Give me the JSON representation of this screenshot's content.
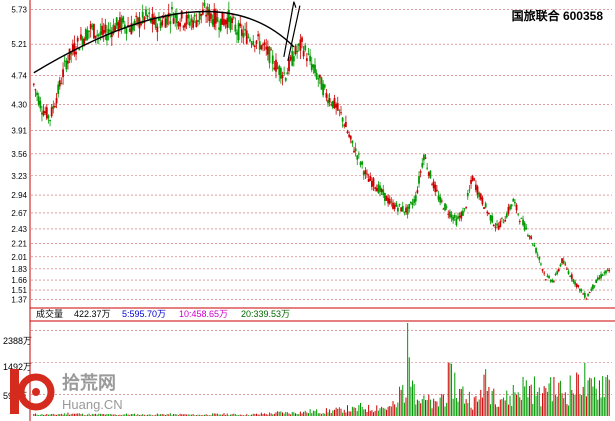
{
  "chart_data": [
    {
      "type": "candlestick",
      "title": "国旅联合 600358",
      "ylim": [
        1.3,
        5.8
      ],
      "y_ticks": [
        5.73,
        5.21,
        4.74,
        4.3,
        3.91,
        3.56,
        3.23,
        2.94,
        2.67,
        2.43,
        2.21,
        2.01,
        1.83,
        1.66,
        1.51,
        1.37
      ],
      "grid": true,
      "trend_points": [
        4.6,
        4.25,
        4.1,
        4.5,
        4.95,
        5.15,
        5.3,
        5.45,
        5.35,
        5.38,
        5.48,
        5.52,
        5.46,
        5.55,
        5.62,
        5.5,
        5.58,
        5.67,
        5.6,
        5.55,
        5.58,
        5.7,
        5.62,
        5.55,
        5.6,
        5.42,
        5.35,
        5.3,
        5.2,
        5.05,
        4.85,
        4.75,
        5.05,
        5.2,
        4.95,
        4.7,
        4.45,
        4.3,
        4.1,
        3.75,
        3.5,
        3.2,
        3.1,
        2.95,
        2.8,
        2.75,
        2.7,
        2.9,
        3.55,
        3.15,
        2.85,
        2.7,
        2.55,
        2.7,
        3.2,
        2.9,
        2.65,
        2.45,
        2.6,
        2.85,
        2.55,
        2.35,
        2.05,
        1.7,
        1.65,
        1.95,
        1.75,
        1.55,
        1.4,
        1.6,
        1.75,
        1.8
      ],
      "annotations": {
        "arc": {
          "from_index": 0,
          "peak_index": 22,
          "to_index": 32,
          "note": "arched top drawn over the price"
        },
        "spike": {
          "index": 32,
          "high": 5.85
        }
      }
    },
    {
      "type": "bar",
      "title": "",
      "legend": {
        "label": "成交量",
        "items": [
          {
            "text": "422.37万",
            "color": "#000000"
          },
          {
            "text": "5:595.70万",
            "color": "#0000cc"
          },
          {
            "text": "10:458.65万",
            "color": "#cc00cc"
          },
          {
            "text": "20:339.53万",
            "color": "#006600"
          }
        ]
      },
      "y_ticks": [
        "2388万",
        "1492万",
        "597万"
      ],
      "ylim": [
        0,
        2600
      ],
      "levels": [
        60,
        55,
        50,
        70,
        90,
        75,
        60,
        55,
        60,
        50,
        45,
        60,
        55,
        50,
        45,
        55,
        60,
        50,
        55,
        45,
        40,
        50,
        60,
        65,
        55,
        50,
        45,
        60,
        80,
        90,
        120,
        110,
        130,
        140,
        160,
        150,
        180,
        200,
        250,
        220,
        300,
        260,
        320,
        280,
        350,
        900,
        2300,
        600,
        500,
        400,
        700,
        1200,
        800,
        650,
        500,
        1100,
        900,
        700,
        600,
        850,
        1000,
        950,
        700,
        1150,
        900,
        800,
        1000,
        1300,
        900,
        1100,
        1250,
        1000
      ],
      "up_color": "#cc0000",
      "down_color": "#009900"
    }
  ],
  "watermark": {
    "number": "10",
    "cn": "拾荒网",
    "en": "Huang.CN"
  },
  "colors": {
    "up": "#cc0000",
    "down": "#009900",
    "grid": "#cc6666",
    "axis_text": "#000000",
    "panel_border": "#cc0000",
    "arc": "#000000",
    "watermark_red": "#d42b1e",
    "watermark_gray": "#9a9a9a"
  }
}
